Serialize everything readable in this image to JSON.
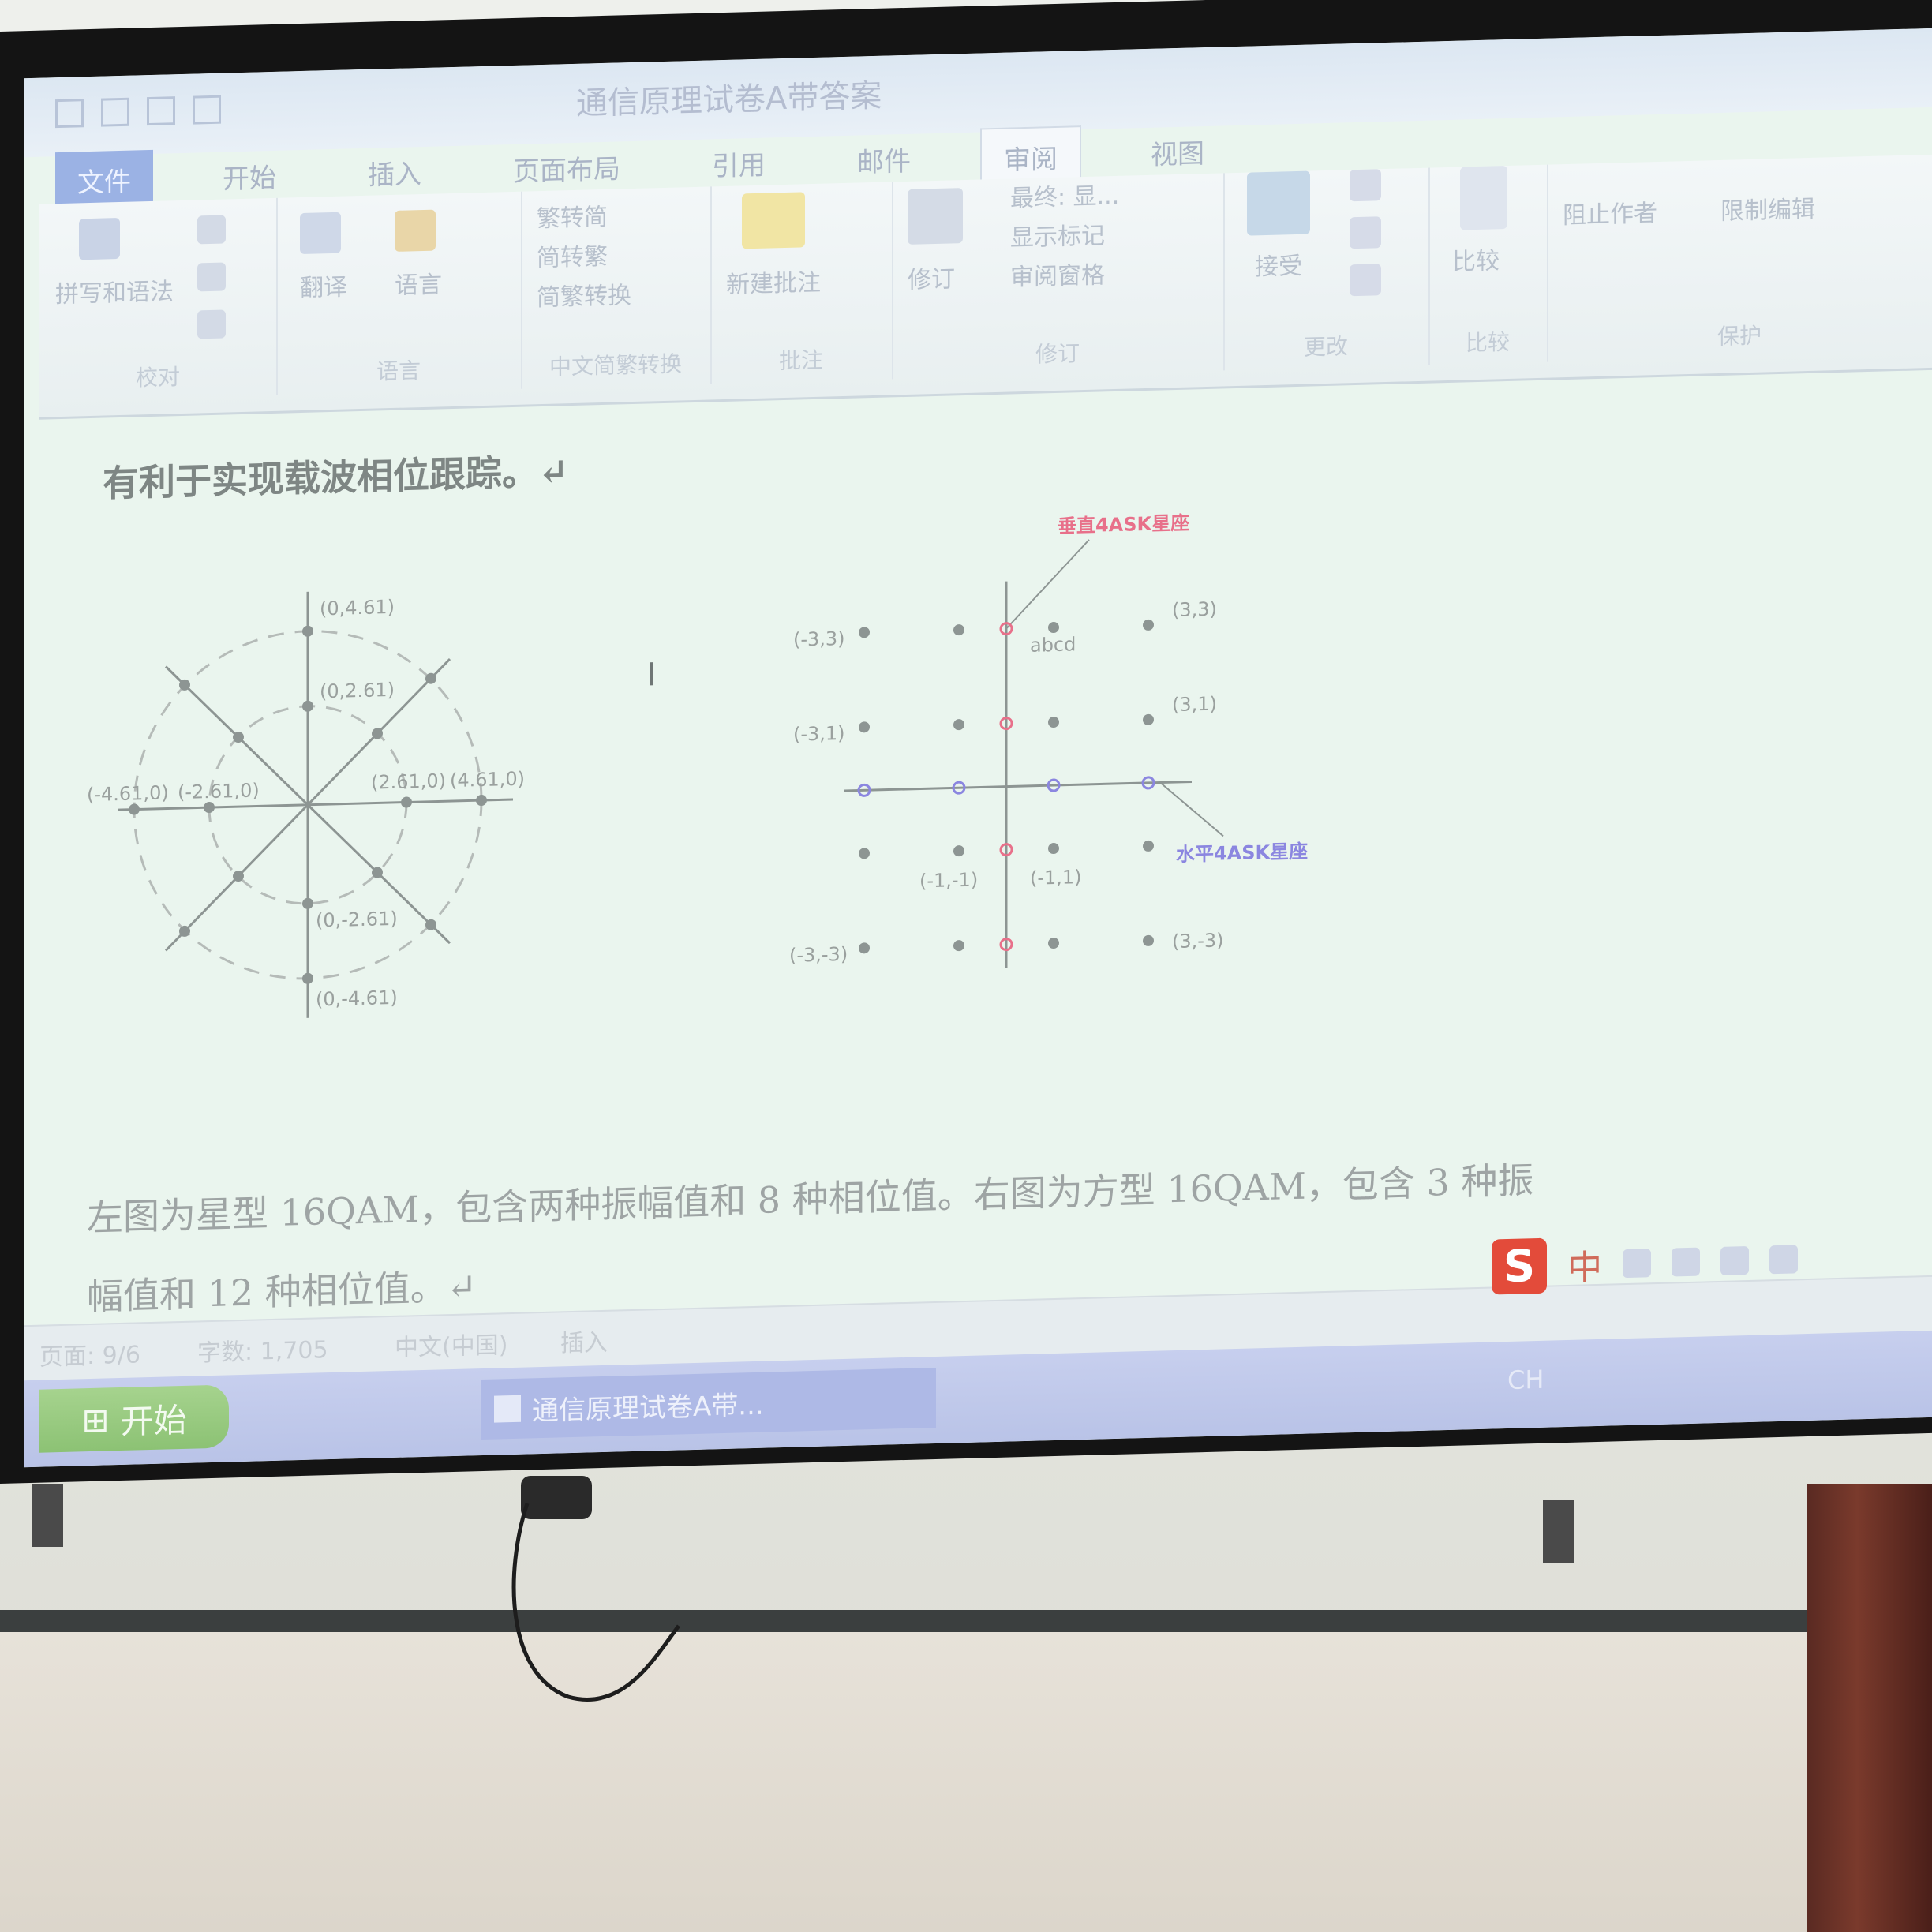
{
  "window": {
    "doc_title": "通信原理试卷A带答案",
    "tabs": [
      "文件",
      "开始",
      "插入",
      "页面布局",
      "引用",
      "邮件",
      "审阅",
      "视图"
    ],
    "active_tab": "审阅"
  },
  "ribbon": {
    "groups": [
      {
        "label": "校对",
        "buttons": [
          "拼写和语法"
        ]
      },
      {
        "label": "语言",
        "buttons": [
          "翻译",
          "语言"
        ]
      },
      {
        "label": "中文简繁转换",
        "buttons": [
          "繁转简",
          "简转繁",
          "简繁转换"
        ]
      },
      {
        "label": "批注",
        "buttons": [
          "新建批注"
        ]
      },
      {
        "label": "修订",
        "buttons": [
          "修订",
          "最终: 显...",
          "显示标记",
          "审阅窗格"
        ]
      },
      {
        "label": "更改",
        "buttons": [
          "接受"
        ]
      },
      {
        "label": "比较",
        "buttons": [
          "比较"
        ]
      },
      {
        "label": "保护",
        "buttons": [
          "阻止作者",
          "限制编辑"
        ]
      }
    ]
  },
  "document": {
    "line1": "有利于实现载波相位跟踪。↵",
    "caption1": "左图为星型 16QAM，包含两种振幅值和 8 种相位值。右图为方型 16QAM，包含 3 种振",
    "caption2": "幅值和 12 种相位值。↵",
    "left_labels": {
      "top_outer": "(0,4.61)",
      "top_inner": "(0,2.61)",
      "left_outer": "(-4.61,0)",
      "left_inner": "(-2.61,0)",
      "right_inner": "(2.61,0)",
      "right_outer": "(4.61,0)",
      "bottom_inner": "(0,-2.61)",
      "bottom_outer": "(0,-4.61)"
    },
    "right_labels": {
      "p_m3_3": "(-3,3)",
      "p_m3_1": "(-3,1)",
      "p_m3_m3": "(-3,-3)",
      "p_3_3": "(3,3)",
      "p_3_1": "(3,1)",
      "p_3_m3": "(3,-3)",
      "p_m1_m1": "(-1,-1)",
      "p_m1_1": "(-1,1)",
      "abcd": "abcd",
      "vertical_ask": "垂直4ASK星座",
      "horizontal_ask": "水平4ASK星座"
    },
    "colors": {
      "vertical_ask": "#e8708a",
      "horizontal_ask": "#8b86e0"
    }
  },
  "statusbar": {
    "page": "页面: 9/6",
    "words": "字数: 1,705",
    "lang": "中文(中国)",
    "mode": "插入"
  },
  "ime": {
    "logo": "S",
    "mode": "中"
  },
  "taskbar": {
    "start": "开始",
    "task": "通信原理试卷A带...",
    "lang": "CH"
  }
}
